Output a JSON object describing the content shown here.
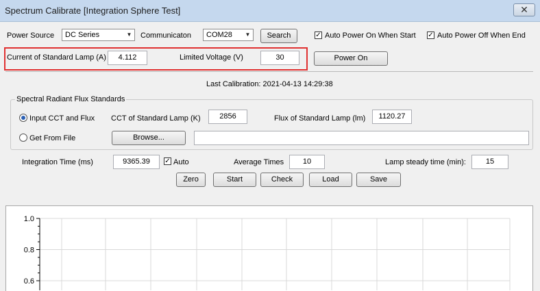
{
  "window": {
    "title": "Spectrum Calibrate [Integration Sphere Test]",
    "close_glyph": "✕"
  },
  "power": {
    "source_label": "Power Source",
    "source_value": "DC Series",
    "comm_label": "Communicaton",
    "comm_value": "COM28",
    "search_label": "Search",
    "auto_on_label": "Auto Power On When Start",
    "auto_on_checked": true,
    "auto_off_label": "Auto Power Off When End",
    "auto_off_checked": true
  },
  "lamp": {
    "current_label": "Current of Standard Lamp (A)",
    "current_value": "4.112",
    "voltage_label": "Limited Voltage (V)",
    "voltage_value": "30",
    "power_on_label": "Power On"
  },
  "last_calibration": "Last Calibration: 2021-04-13 14:29:38",
  "flux": {
    "group_label": "Spectral Radiant Flux Standards",
    "input_label": "Input CCT and Flux",
    "input_selected": true,
    "file_label": "Get From File",
    "file_selected": false,
    "cct_label": "CCT of Standard Lamp (K)",
    "cct_value": "2856",
    "flux_label": "Flux of Standard Lamp (lm)",
    "flux_value": "1120.27",
    "browse_label": "Browse...",
    "file_path": ""
  },
  "measure": {
    "integration_label": "Integration Time (ms)",
    "integration_value": "9365.39",
    "auto_label": "Auto",
    "auto_checked": true,
    "avg_label": "Average Times",
    "avg_value": "10",
    "steady_label": "Lamp steady time (min):",
    "steady_value": "15"
  },
  "actions": {
    "zero": "Zero",
    "start": "Start",
    "check": "Check",
    "load": "Load",
    "save": "Save"
  },
  "chart_data": {
    "type": "line",
    "title": "",
    "xlabel": "",
    "ylabel": "",
    "yticks": [
      "1.0",
      "0.8",
      "0.6"
    ],
    "ylim": [
      0.6,
      1.0
    ],
    "grid": true,
    "series": []
  }
}
